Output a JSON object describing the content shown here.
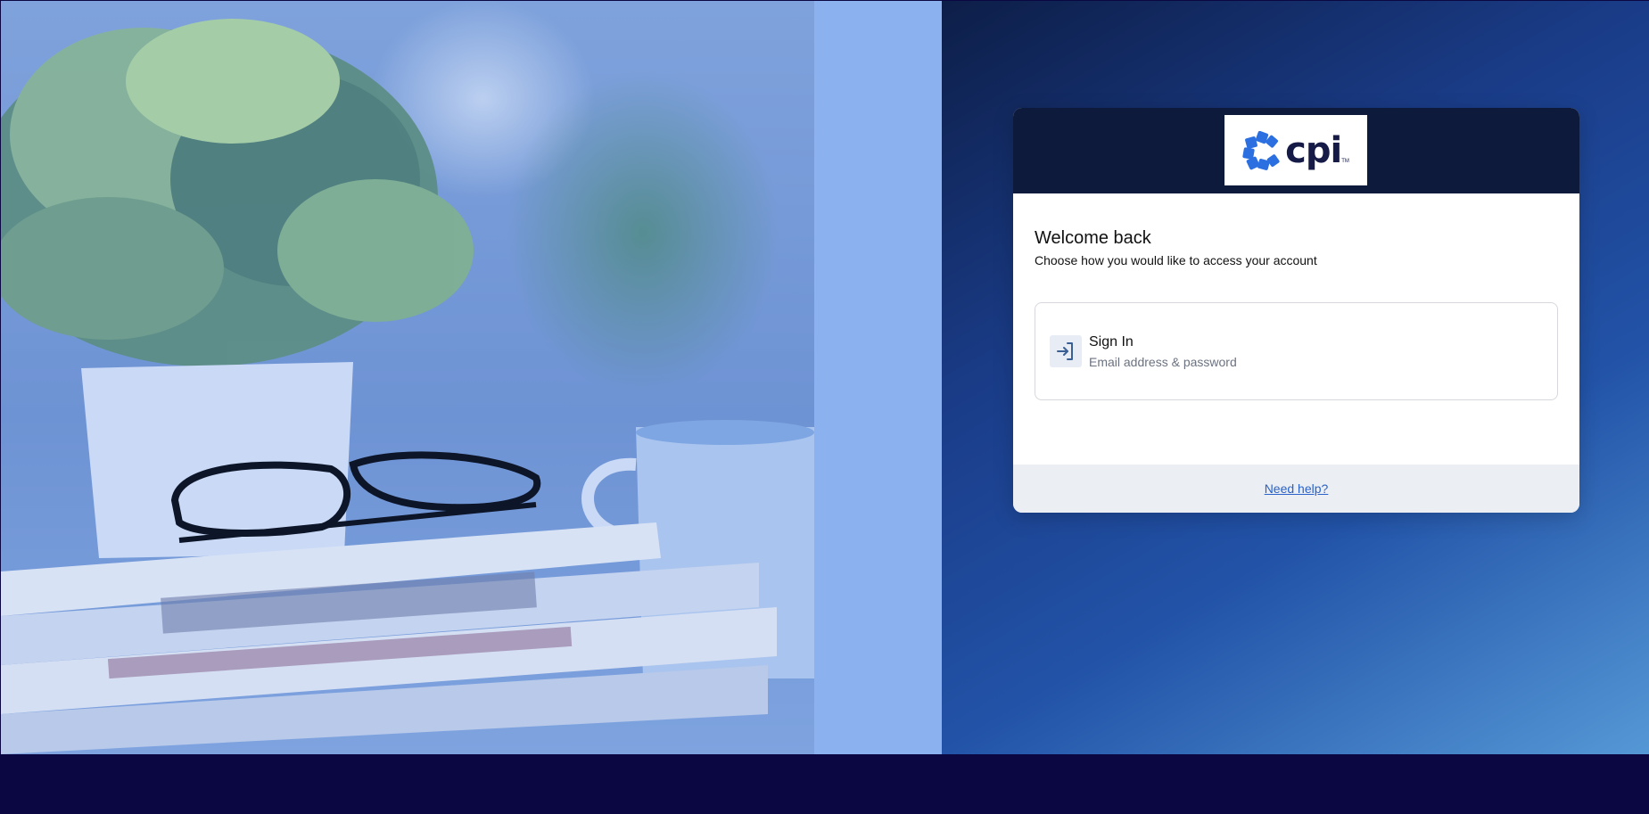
{
  "brand": {
    "logo_alt": "cpi",
    "logo_text": "cpi",
    "logo_tm": "TM",
    "logo_color": "#2b6fe0",
    "header_bg": "#0e1a3b"
  },
  "login": {
    "title": "Welcome back",
    "subtitle": "Choose how you would like to access your account",
    "options": [
      {
        "icon": "sign-in-icon",
        "label": "Sign In",
        "description": "Email address & password"
      }
    ],
    "help_link": "Need help?"
  },
  "background": {
    "left_image": "plant-glasses-newspapers-photo",
    "tint_color": "#8bb1ee",
    "right_gradient": [
      "#0d1e48",
      "#5598d6"
    ]
  }
}
